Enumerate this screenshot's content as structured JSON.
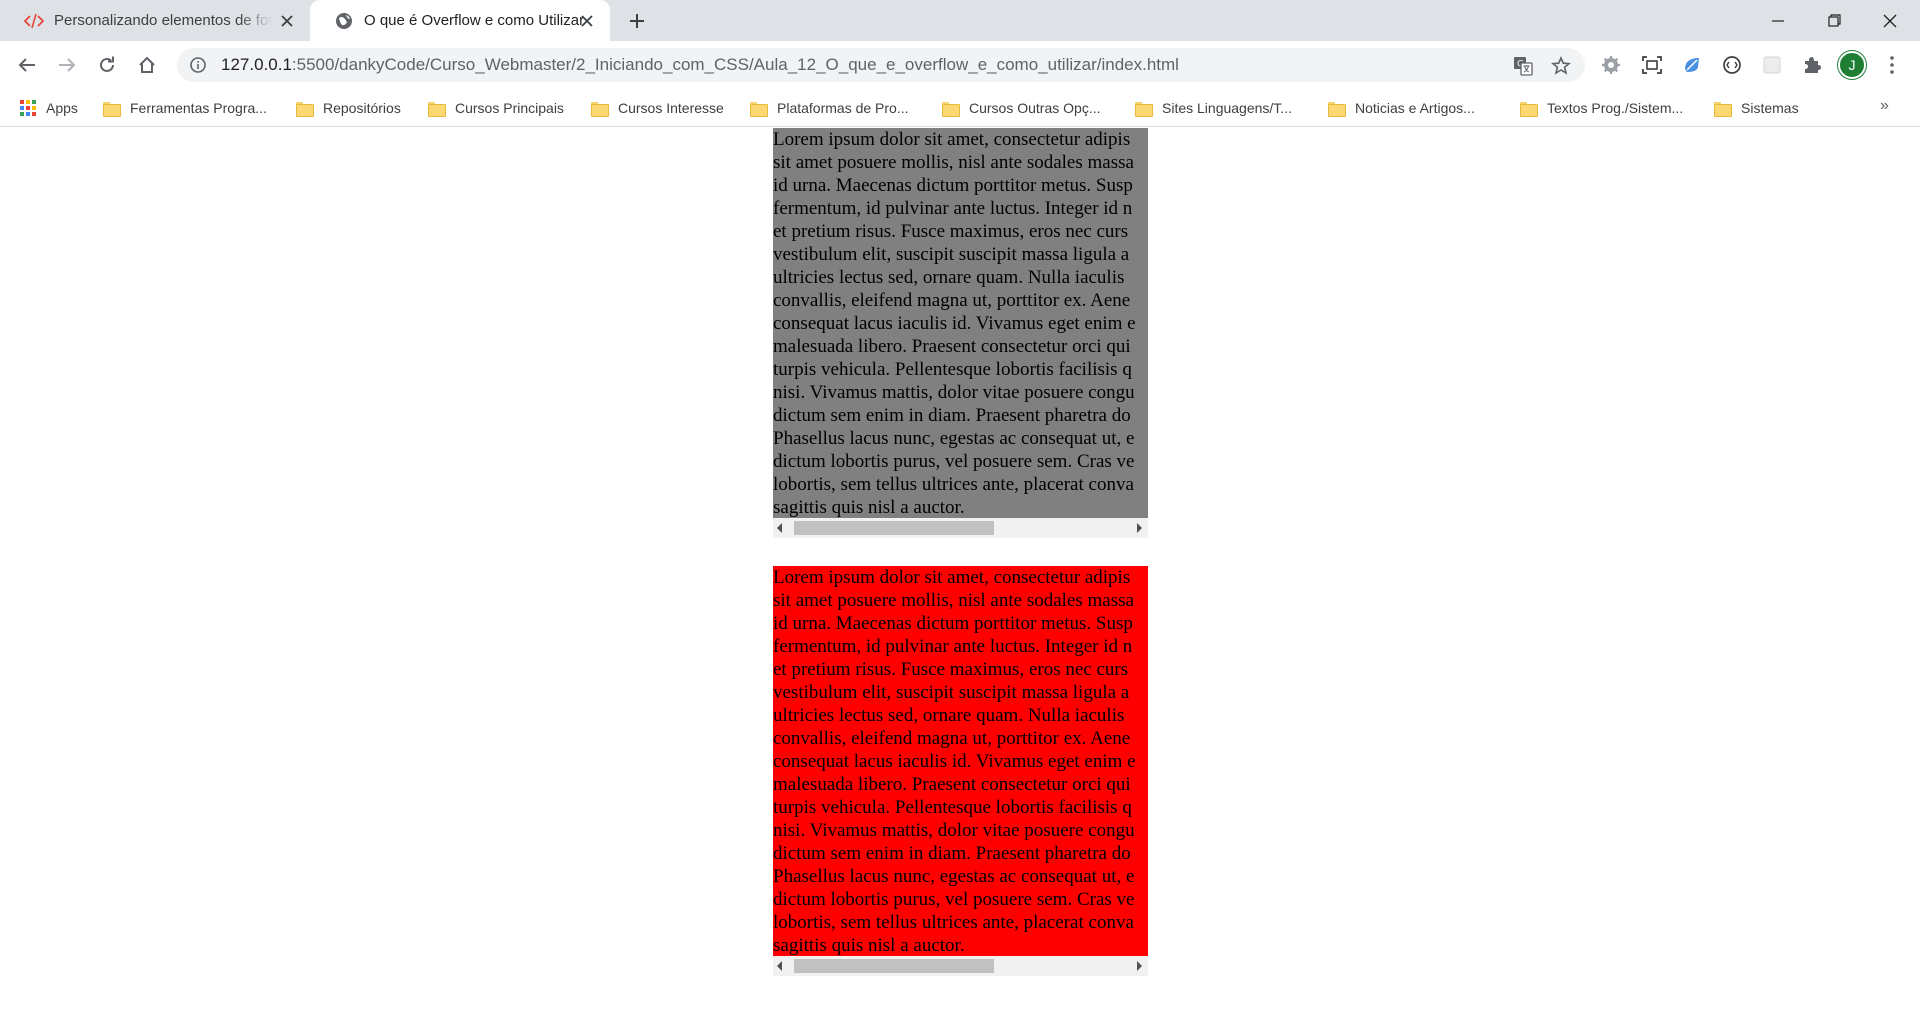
{
  "browser": {
    "tabs": [
      {
        "title": "Personalizando elementos de for",
        "icon": "code-icon",
        "active": false
      },
      {
        "title": "O que é Overflow e como Utilizar",
        "icon": "globe-icon",
        "active": true
      }
    ],
    "url_host": "127.0.0.1",
    "url_path": ":5500/dankyCode/Curso_Webmaster/2_Iniciando_com_CSS/Aula_12_O_que_e_overflow_e_como_utilizar/index.html",
    "profile_initial": "J"
  },
  "bookmarks": [
    {
      "label": "Apps",
      "icon": "apps-grid-icon"
    },
    {
      "label": "Ferramentas Progra...",
      "icon": "folder-icon"
    },
    {
      "label": "Repositórios",
      "icon": "folder-icon"
    },
    {
      "label": "Cursos Principais",
      "icon": "folder-icon"
    },
    {
      "label": "Cursos Interesse",
      "icon": "folder-icon"
    },
    {
      "label": "Plataformas de Pro...",
      "icon": "folder-icon"
    },
    {
      "label": "Cursos Outras Opç...",
      "icon": "folder-icon"
    },
    {
      "label": "Sites Linguagens/T...",
      "icon": "folder-icon"
    },
    {
      "label": "Noticias e Artigos...",
      "icon": "folder-icon"
    },
    {
      "label": "Textos Prog./Sistem...",
      "icon": "folder-icon"
    },
    {
      "label": "Sistemas",
      "icon": "folder-icon"
    }
  ],
  "boxes": [
    {
      "background": "#808080",
      "lines": [
        "Lorem ipsum dolor sit amet, consectetur adipis",
        "sit amet posuere mollis, nisl ante sodales massa",
        "id urna. Maecenas dictum porttitor metus. Susp",
        "fermentum, id pulvinar ante luctus. Integer id n",
        "et pretium risus. Fusce maximus, eros nec curs",
        "vestibulum elit, suscipit suscipit massa ligula a",
        "ultricies lectus sed, ornare quam. Nulla iaculis",
        "convallis, eleifend magna ut, porttitor ex. Aene",
        "consequat lacus iaculis id. Vivamus eget enim e",
        "malesuada libero. Praesent consectetur orci qui",
        "turpis vehicula. Pellentesque lobortis facilisis q",
        "nisi. Vivamus mattis, dolor vitae posuere congu",
        "dictum sem enim in diam. Praesent pharetra do",
        "Phasellus lacus nunc, egestas ac consequat ut, e",
        "dictum lobortis purus, vel posuere sem. Cras ve",
        "lobortis, sem tellus ultrices ante, placerat conva",
        "sagittis quis nisl a auctor."
      ]
    },
    {
      "background": "#ff0000",
      "lines": [
        "Lorem ipsum dolor sit amet, consectetur adipis",
        "sit amet posuere mollis, nisl ante sodales massa",
        "id urna. Maecenas dictum porttitor metus. Susp",
        "fermentum, id pulvinar ante luctus. Integer id n",
        "et pretium risus. Fusce maximus, eros nec curs",
        "vestibulum elit, suscipit suscipit massa ligula a",
        "ultricies lectus sed, ornare quam. Nulla iaculis",
        "convallis, eleifend magna ut, porttitor ex. Aene",
        "consequat lacus iaculis id. Vivamus eget enim e",
        "malesuada libero. Praesent consectetur orci qui",
        "turpis vehicula. Pellentesque lobortis facilisis q",
        "nisi. Vivamus mattis, dolor vitae posuere congu",
        "dictum sem enim in diam. Praesent pharetra do",
        "Phasellus lacus nunc, egestas ac consequat ut, e",
        "dictum lobortis purus, vel posuere sem. Cras ve",
        "lobortis, sem tellus ultrices ante, placerat conva",
        "sagittis quis nisl a auctor."
      ]
    }
  ]
}
